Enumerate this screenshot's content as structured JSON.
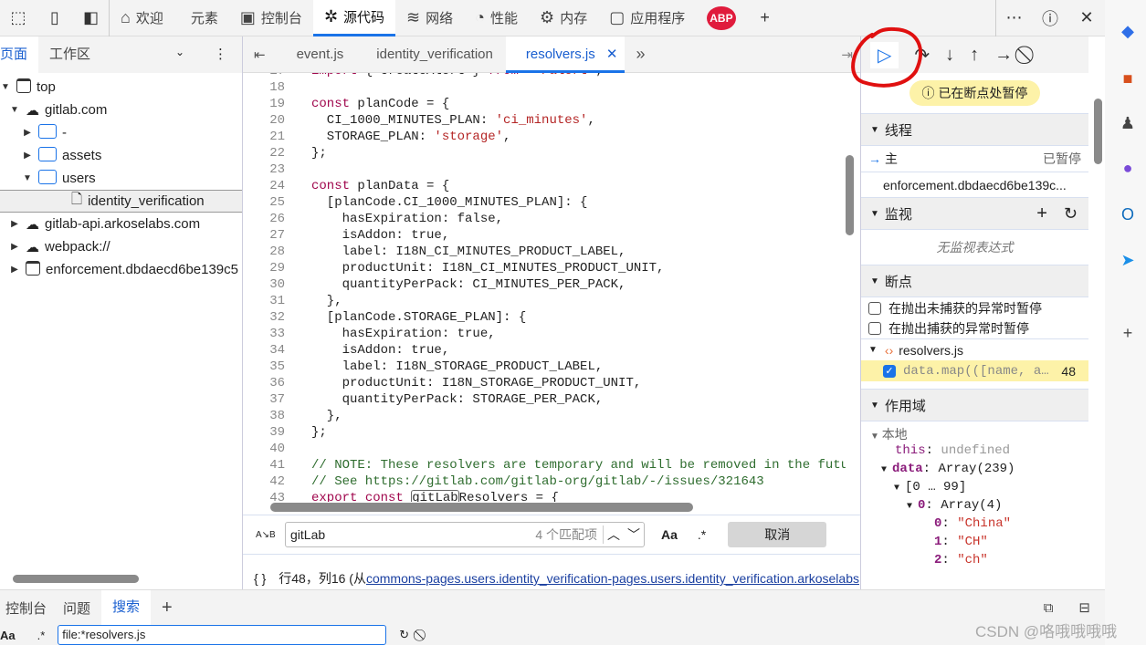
{
  "toolbar": {
    "tabs": [
      {
        "label": "欢迎",
        "icon": "home-icon"
      },
      {
        "label": "元素",
        "icon": "code-tag-icon"
      },
      {
        "label": "控制台",
        "icon": "console-warning-icon"
      },
      {
        "label": "源代码",
        "icon": "bug-icon",
        "active": true
      },
      {
        "label": "网络",
        "icon": "wifi-icon"
      },
      {
        "label": "性能",
        "icon": "gauge-icon"
      },
      {
        "label": "内存",
        "icon": "chip-icon"
      },
      {
        "label": "应用程序",
        "icon": "window-icon"
      }
    ],
    "abp": "ABP"
  },
  "navigator": {
    "tabs": [
      "页面",
      "工作区"
    ],
    "tree": [
      {
        "label": "top",
        "depth": 0,
        "arrow": "▼",
        "icon": "frame"
      },
      {
        "label": "gitlab.com",
        "depth": 1,
        "arrow": "▼",
        "icon": "cloud"
      },
      {
        "label": "-",
        "depth": 2,
        "arrow": "▶",
        "icon": "folder"
      },
      {
        "label": "assets",
        "depth": 2,
        "arrow": "▶",
        "icon": "folder"
      },
      {
        "label": "users",
        "depth": 2,
        "arrow": "▼",
        "icon": "folder"
      },
      {
        "label": "identity_verification",
        "depth": 3,
        "arrow": "",
        "icon": "file",
        "selected": true
      },
      {
        "label": "gitlab-api.arkoselabs.com",
        "depth": 1,
        "arrow": "▶",
        "icon": "cloud"
      },
      {
        "label": "webpack://",
        "depth": 1,
        "arrow": "▶",
        "icon": "cloud"
      },
      {
        "label": "enforcement.dbdaecd6be139c5",
        "depth": 1,
        "arrow": "▶",
        "icon": "frame"
      }
    ]
  },
  "editor": {
    "tabs": [
      "event.js",
      "identity_verification",
      "resolvers.js"
    ],
    "active_tab": "resolvers.js",
    "lines": [
      [
        17,
        "import { createAlert } from '~/alert';"
      ],
      [
        18,
        ""
      ],
      [
        19,
        "const planCode = {"
      ],
      [
        20,
        "  CI_1000_MINUTES_PLAN: 'ci_minutes',"
      ],
      [
        21,
        "  STORAGE_PLAN: 'storage',"
      ],
      [
        22,
        "};"
      ],
      [
        23,
        ""
      ],
      [
        24,
        "const planData = {"
      ],
      [
        25,
        "  [planCode.CI_1000_MINUTES_PLAN]: {"
      ],
      [
        26,
        "    hasExpiration: false,"
      ],
      [
        27,
        "    isAddon: true,"
      ],
      [
        28,
        "    label: I18N_CI_MINUTES_PRODUCT_LABEL,"
      ],
      [
        29,
        "    productUnit: I18N_CI_MINUTES_PRODUCT_UNIT,"
      ],
      [
        30,
        "    quantityPerPack: CI_MINUTES_PER_PACK,"
      ],
      [
        31,
        "  },"
      ],
      [
        32,
        "  [planCode.STORAGE_PLAN]: {"
      ],
      [
        33,
        "    hasExpiration: true,"
      ],
      [
        34,
        "    isAddon: true,"
      ],
      [
        35,
        "    label: I18N_STORAGE_PRODUCT_LABEL,"
      ],
      [
        36,
        "    productUnit: I18N_STORAGE_PRODUCT_UNIT,"
      ],
      [
        37,
        "    quantityPerPack: STORAGE_PER_PACK,"
      ],
      [
        38,
        "  },"
      ],
      [
        39,
        "};"
      ],
      [
        40,
        ""
      ],
      [
        41,
        "// NOTE: These resolvers are temporary and will be removed in the future"
      ],
      [
        42,
        "// See https://gitlab.com/gitlab-org/gitlab/-/issues/321643"
      ],
      [
        43,
        "export const gitLabResolvers = {"
      ]
    ],
    "search": {
      "value": "gitLab",
      "count": "4 个匹配项",
      "case_label": "Aa",
      "regex_label": ".*",
      "cancel": "取消"
    },
    "status": {
      "position": "行48，列16 (从",
      "link": "commons-pages.users.identity_verification-pages.users.identity_verification.arkoselabs"
    }
  },
  "debugger": {
    "paused": "已在断点处暂停",
    "threads": {
      "title": "线程",
      "main": "主",
      "main_status": "已暂停",
      "other": "enforcement.dbdaecd6be139c..."
    },
    "watch": {
      "title": "监视",
      "empty": "无监视表达式"
    },
    "breakpoints": {
      "title": "断点",
      "uncaught": "在抛出未捕获的异常时暂停",
      "caught": "在抛出捕获的异常时暂停",
      "file": "resolvers.js",
      "bp_code": "data.map(([name, a…",
      "bp_line": "48"
    },
    "scope": {
      "title": "作用域",
      "local": "本地",
      "this_key": "this",
      "this_val": "undefined",
      "data_key": "data",
      "data_val": "Array(239)",
      "range": "[0 … 99]",
      "item_key": "0",
      "item_val": "Array(4)",
      "entries": [
        [
          "0",
          "\"China\""
        ],
        [
          "1",
          "\"CH\""
        ],
        [
          "2",
          "\"ch\""
        ]
      ]
    }
  },
  "drawer": {
    "tabs": [
      "控制台",
      "问题",
      "搜索"
    ],
    "active": "搜索",
    "search_value": "file:*resolvers.js",
    "case_label": "Aa",
    "regex_label": ".*"
  },
  "watermark": "CSDN @咯哦哦哦哦",
  "colors": {
    "accent": "#1a73e8",
    "paused_bg": "#fdf2a8",
    "annotation": "#e01010"
  }
}
